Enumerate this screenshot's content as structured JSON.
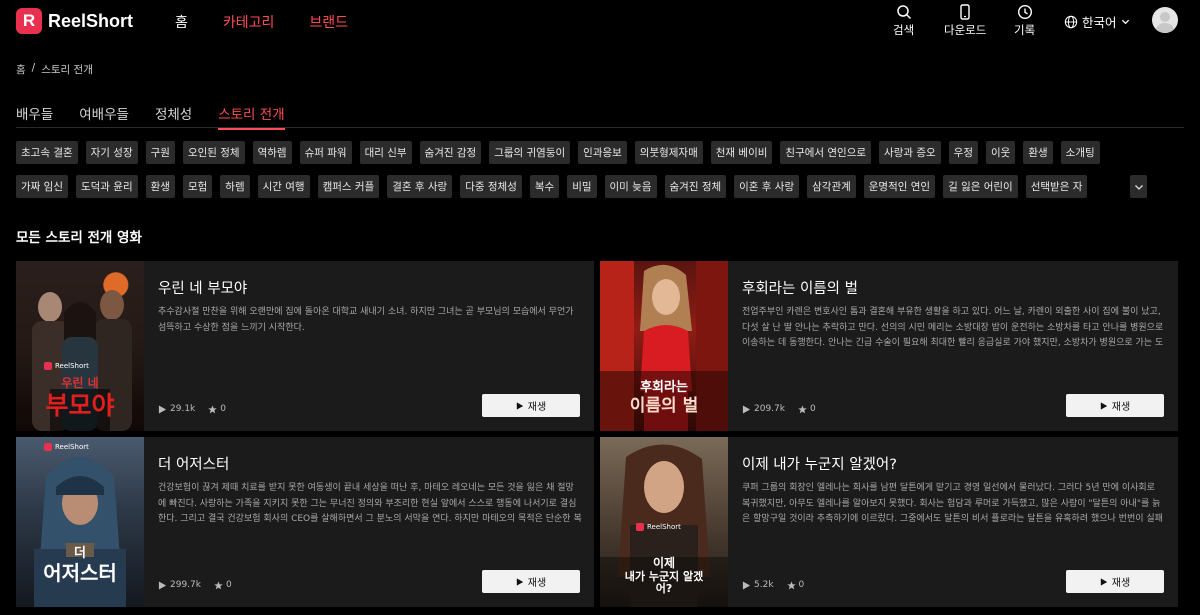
{
  "brand": {
    "name": "ReelShort",
    "logo_letter": "R",
    "accent": "#ff4d57"
  },
  "nav": {
    "items": [
      "홈",
      "카테고리",
      "브랜드"
    ]
  },
  "header_actions": {
    "search": "검색",
    "download": "다운로드",
    "history": "기록",
    "language": "한국어"
  },
  "breadcrumb": {
    "home": "홈",
    "sep": "/",
    "current": "스토리 전개"
  },
  "tabs": [
    "배우들",
    "여배우들",
    "정체성",
    "스토리 전개"
  ],
  "active_tab": "스토리 전개",
  "tags_row1": [
    "초고속 결혼",
    "자기 성장",
    "구원",
    "오인된 정체",
    "역하렘",
    "슈퍼 파워",
    "대리 신부",
    "숨겨진 감정",
    "그룹의 귀염둥이",
    "인과응보",
    "의붓형제자매",
    "천재 베이비",
    "친구에서 연인으로",
    "사랑과 증오",
    "우정",
    "이웃",
    "환생",
    "소개팅"
  ],
  "tags_row2": [
    "가짜 임신",
    "도덕과 윤리",
    "환생",
    "모험",
    "하렘",
    "시간 여행",
    "캠퍼스 커플",
    "결혼 후 사랑",
    "다중 정체성",
    "복수",
    "비밀",
    "이미 늦음",
    "숨겨진 정체",
    "이혼 후 사랑",
    "삼각관계",
    "운명적인 연인",
    "길 잃은 어린이",
    "선택받은 자"
  ],
  "section_title": "모든 스토리 전개 영화",
  "cards": [
    {
      "title": "우린 네 부모야",
      "desc": "추수감사절 만찬을 위해 오랜만에 집에 돌아온 대학교 새내기 소녀. 하지만 그녀는 곧 부모님의 모습에서 무언가 섬뜩하고 수상한 점을 느끼기 시작한다.",
      "views": "29.1k",
      "likes": "0",
      "play": "재생",
      "poster_brand": "ReelShort",
      "poster_title_small": "우린 네",
      "poster_title_big": "부모야"
    },
    {
      "title": "후회라는 이름의 벌",
      "desc": "전업주부인 카렌은 변호사인 톰과 결혼해 부유한 생활을 하고 있다. 어느 날, 카렌이 외출한 사이 집에 불이 났고, 다섯 살 난 딸 안나는 추락하고 만다. 선의의 시민 메리는 소방대장 밥이 운전하는 소방차를 타고 안나를 병원으로 이송하는 데 동행한다. 안나는 긴급 수술이 필요해 최대한 빨리 응급실로 가야 했지만, 소방차가 병원으로 가는 도중, 바람을 피우고 든...",
      "views": "209.7k",
      "likes": "0",
      "play": "재생",
      "poster_brand": "",
      "poster_title_small": "후회라는",
      "poster_title_big": "이름의 벌"
    },
    {
      "title": "더 어저스터",
      "desc": "건강보험이 끊겨 제때 치료를 받지 못한 여동생이 끝내 세상을 떠난 후, 마테오 레오네는 모든 것을 잃은 채 절망에 빠진다. 사랑하는 가족을 지키지 못한 그는 무너진 정의와 부조리한 현실 앞에서 스스로 행동에 나서기로 결심한다. 그리고 결국 건강보험 회사의 CEO를 살해하면서 그 분노의 서막을 연다. 하지만 마테오의 목적은 단순한 복수가 아니다. 그는 악자...",
      "views": "299.7k",
      "likes": "0",
      "play": "재생",
      "poster_brand": "ReelShort",
      "poster_title_small": "더",
      "poster_title_big": "어저스터"
    },
    {
      "title": "이제 내가 누군지 알겠어?",
      "desc": "쿠퍼 그룹의 회장인 엘레나는 회사를 남편 달튼에게 맡기고 경영 일선에서 물러났다. 그러다 5년 만에 이사회로 복귀했지만, 아무도 엘레나를 알아보지 못했다. 회사는 험담과 루머로 가득했고, 많은 사람이 \"달튼의 아내\"를 늙은 할망구일 것이라 추측하기에 이르렀다. 그중에서도 달튼의 비서 플로라는 달튼을 유혹하려 했으나 번번이 실패했다. 어느 날, 달튼과...",
      "views": "5.2k",
      "likes": "0",
      "play": "재생",
      "poster_brand": "ReelShort",
      "poster_title_small": "이제",
      "poster_title_big": "내가 누군지 알겠어?"
    }
  ]
}
